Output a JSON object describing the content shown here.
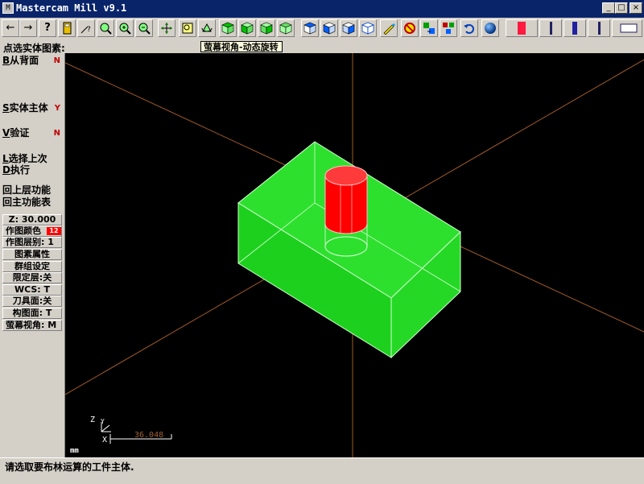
{
  "window": {
    "app_icon": "M",
    "title": "Mastercam Mill v9.1",
    "minimize": "_",
    "maximize": "□",
    "close": "×"
  },
  "toolbar": {
    "prev_label": "←",
    "next_label": "→",
    "help_label": "?"
  },
  "prompt": "点选实体图素:",
  "tooltip": "萤幕视角-动态旋转",
  "menu": {
    "items": [
      {
        "key": "B",
        "label": "从背面",
        "flag": "N"
      },
      {
        "key": "S",
        "label": "实体主体",
        "flag": "Y"
      },
      {
        "key": "V",
        "label": "验证",
        "flag": "N"
      },
      {
        "key": "L",
        "label": "选择上次",
        "flag": ""
      },
      {
        "key": "D",
        "label": "执行",
        "flag": ""
      }
    ],
    "back_function": "回上层功能",
    "main_function": "回主功能表"
  },
  "secondary": {
    "z_depth": "Z: 30.000",
    "color_label": "作图颜色",
    "color_value": "12",
    "level": "作图层别: 1",
    "entity_attributes": "图素属性",
    "group_settings": "群组设定",
    "limit_levels": "限定层:关",
    "wcs": "WCS: T",
    "tool_plane": "刀具面:关",
    "construction_plane": "构图面: T",
    "screen_view": "萤幕视角: M"
  },
  "viewport": {
    "gnomon_z": "Z",
    "gnomon_y": "Y",
    "gnomon_x": "X",
    "scale_value": "36.048",
    "units": "mm"
  },
  "status_message": "请选取要布林运算的工件主体.",
  "colors": {
    "solid_green": "#22e022",
    "cylinder_red": "#ff0000",
    "axis_orange": "#a05a28",
    "title_blue": "#0a246a"
  }
}
